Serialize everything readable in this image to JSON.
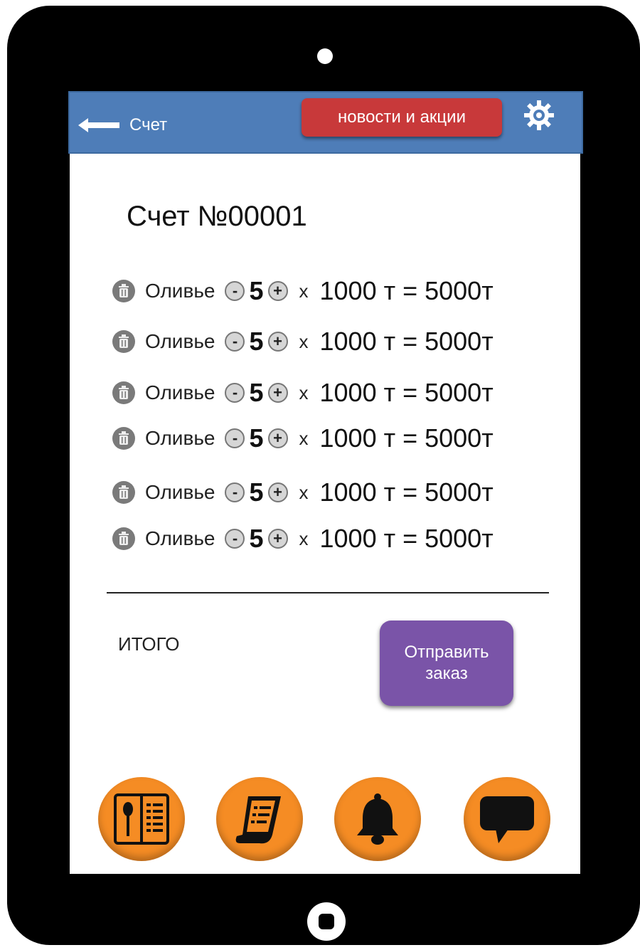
{
  "header": {
    "back_label": "Счет",
    "news_button": "новости и акции",
    "settings_icon": "gear-icon"
  },
  "bill": {
    "title": "Счет №00001",
    "items": [
      {
        "name": "Оливье",
        "qty": "5",
        "times": "x",
        "price": "1000 т = 5000т"
      },
      {
        "name": "Оливье",
        "qty": "5",
        "times": "x",
        "price": "1000 т = 5000т"
      },
      {
        "name": "Оливье",
        "qty": "5",
        "times": "x",
        "price": "1000 т = 5000т"
      },
      {
        "name": "Оливье",
        "qty": "5",
        "times": "x",
        "price": "1000 т = 5000т"
      },
      {
        "name": "Оливье",
        "qty": "5",
        "times": "x",
        "price": "1000 т = 5000т"
      },
      {
        "name": "Оливье",
        "qty": "5",
        "times": "x",
        "price": "1000 т = 5000т"
      }
    ],
    "minus_symbol": "-",
    "plus_symbol": "+"
  },
  "footer": {
    "total_label": "ИТОГО",
    "submit_label": "Отправить заказ"
  },
  "bottom_nav": [
    {
      "icon": "menu-book-icon"
    },
    {
      "icon": "receipt-icon"
    },
    {
      "icon": "bell-icon"
    },
    {
      "icon": "chat-icon"
    }
  ],
  "colors": {
    "header_bg": "#4e7db8",
    "news_button": "#c8393a",
    "submit_button": "#7a54a8",
    "nav_button": "#f58c24"
  }
}
